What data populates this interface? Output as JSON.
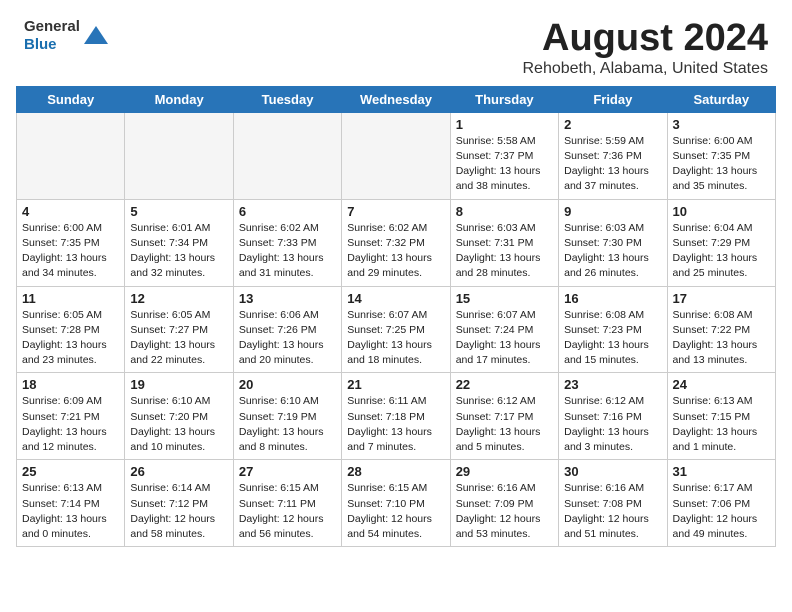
{
  "header": {
    "logo_general": "General",
    "logo_blue": "Blue",
    "month_title": "August 2024",
    "subtitle": "Rehobeth, Alabama, United States"
  },
  "days_of_week": [
    "Sunday",
    "Monday",
    "Tuesday",
    "Wednesday",
    "Thursday",
    "Friday",
    "Saturday"
  ],
  "weeks": [
    [
      {
        "day": "",
        "info": "",
        "empty": true
      },
      {
        "day": "",
        "info": "",
        "empty": true
      },
      {
        "day": "",
        "info": "",
        "empty": true
      },
      {
        "day": "",
        "info": "",
        "empty": true
      },
      {
        "day": "1",
        "info": "Sunrise: 5:58 AM\nSunset: 7:37 PM\nDaylight: 13 hours\nand 38 minutes."
      },
      {
        "day": "2",
        "info": "Sunrise: 5:59 AM\nSunset: 7:36 PM\nDaylight: 13 hours\nand 37 minutes."
      },
      {
        "day": "3",
        "info": "Sunrise: 6:00 AM\nSunset: 7:35 PM\nDaylight: 13 hours\nand 35 minutes."
      }
    ],
    [
      {
        "day": "4",
        "info": "Sunrise: 6:00 AM\nSunset: 7:35 PM\nDaylight: 13 hours\nand 34 minutes."
      },
      {
        "day": "5",
        "info": "Sunrise: 6:01 AM\nSunset: 7:34 PM\nDaylight: 13 hours\nand 32 minutes."
      },
      {
        "day": "6",
        "info": "Sunrise: 6:02 AM\nSunset: 7:33 PM\nDaylight: 13 hours\nand 31 minutes."
      },
      {
        "day": "7",
        "info": "Sunrise: 6:02 AM\nSunset: 7:32 PM\nDaylight: 13 hours\nand 29 minutes."
      },
      {
        "day": "8",
        "info": "Sunrise: 6:03 AM\nSunset: 7:31 PM\nDaylight: 13 hours\nand 28 minutes."
      },
      {
        "day": "9",
        "info": "Sunrise: 6:03 AM\nSunset: 7:30 PM\nDaylight: 13 hours\nand 26 minutes."
      },
      {
        "day": "10",
        "info": "Sunrise: 6:04 AM\nSunset: 7:29 PM\nDaylight: 13 hours\nand 25 minutes."
      }
    ],
    [
      {
        "day": "11",
        "info": "Sunrise: 6:05 AM\nSunset: 7:28 PM\nDaylight: 13 hours\nand 23 minutes."
      },
      {
        "day": "12",
        "info": "Sunrise: 6:05 AM\nSunset: 7:27 PM\nDaylight: 13 hours\nand 22 minutes."
      },
      {
        "day": "13",
        "info": "Sunrise: 6:06 AM\nSunset: 7:26 PM\nDaylight: 13 hours\nand 20 minutes."
      },
      {
        "day": "14",
        "info": "Sunrise: 6:07 AM\nSunset: 7:25 PM\nDaylight: 13 hours\nand 18 minutes."
      },
      {
        "day": "15",
        "info": "Sunrise: 6:07 AM\nSunset: 7:24 PM\nDaylight: 13 hours\nand 17 minutes."
      },
      {
        "day": "16",
        "info": "Sunrise: 6:08 AM\nSunset: 7:23 PM\nDaylight: 13 hours\nand 15 minutes."
      },
      {
        "day": "17",
        "info": "Sunrise: 6:08 AM\nSunset: 7:22 PM\nDaylight: 13 hours\nand 13 minutes."
      }
    ],
    [
      {
        "day": "18",
        "info": "Sunrise: 6:09 AM\nSunset: 7:21 PM\nDaylight: 13 hours\nand 12 minutes."
      },
      {
        "day": "19",
        "info": "Sunrise: 6:10 AM\nSunset: 7:20 PM\nDaylight: 13 hours\nand 10 minutes."
      },
      {
        "day": "20",
        "info": "Sunrise: 6:10 AM\nSunset: 7:19 PM\nDaylight: 13 hours\nand 8 minutes."
      },
      {
        "day": "21",
        "info": "Sunrise: 6:11 AM\nSunset: 7:18 PM\nDaylight: 13 hours\nand 7 minutes."
      },
      {
        "day": "22",
        "info": "Sunrise: 6:12 AM\nSunset: 7:17 PM\nDaylight: 13 hours\nand 5 minutes."
      },
      {
        "day": "23",
        "info": "Sunrise: 6:12 AM\nSunset: 7:16 PM\nDaylight: 13 hours\nand 3 minutes."
      },
      {
        "day": "24",
        "info": "Sunrise: 6:13 AM\nSunset: 7:15 PM\nDaylight: 13 hours\nand 1 minute."
      }
    ],
    [
      {
        "day": "25",
        "info": "Sunrise: 6:13 AM\nSunset: 7:14 PM\nDaylight: 13 hours\nand 0 minutes."
      },
      {
        "day": "26",
        "info": "Sunrise: 6:14 AM\nSunset: 7:12 PM\nDaylight: 12 hours\nand 58 minutes."
      },
      {
        "day": "27",
        "info": "Sunrise: 6:15 AM\nSunset: 7:11 PM\nDaylight: 12 hours\nand 56 minutes."
      },
      {
        "day": "28",
        "info": "Sunrise: 6:15 AM\nSunset: 7:10 PM\nDaylight: 12 hours\nand 54 minutes."
      },
      {
        "day": "29",
        "info": "Sunrise: 6:16 AM\nSunset: 7:09 PM\nDaylight: 12 hours\nand 53 minutes."
      },
      {
        "day": "30",
        "info": "Sunrise: 6:16 AM\nSunset: 7:08 PM\nDaylight: 12 hours\nand 51 minutes."
      },
      {
        "day": "31",
        "info": "Sunrise: 6:17 AM\nSunset: 7:06 PM\nDaylight: 12 hours\nand 49 minutes."
      }
    ]
  ]
}
